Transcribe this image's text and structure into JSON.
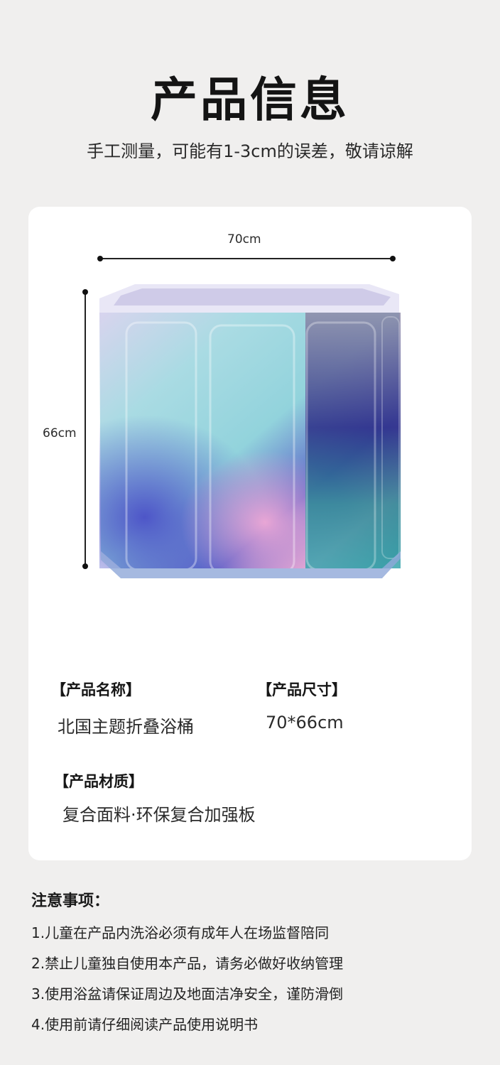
{
  "header": {
    "title": "产品信息",
    "subtitle": "手工测量，可能有1-3cm的误差，敬请谅解"
  },
  "diagram": {
    "width_label": "70cm",
    "height_label": "66cm"
  },
  "specs": {
    "name_heading": "【产品名称】",
    "name_value": "北国主题折叠浴桶",
    "size_heading": "【产品尺寸】",
    "size_value": "70*66cm",
    "material_heading": "【产品材质】",
    "material_value": "复合面料·环保复合加强板"
  },
  "notes": {
    "title": "注意事项：",
    "items": [
      "1.儿童在产品内洗浴必须有成年人在场监督陪同",
      "2.禁止儿童独自使用本产品，请务必做好收纳管理",
      "3.使用浴盆请保证周边及地面洁净安全，谨防滑倒",
      "4.使用前请仔细阅读产品使用说明书"
    ]
  }
}
